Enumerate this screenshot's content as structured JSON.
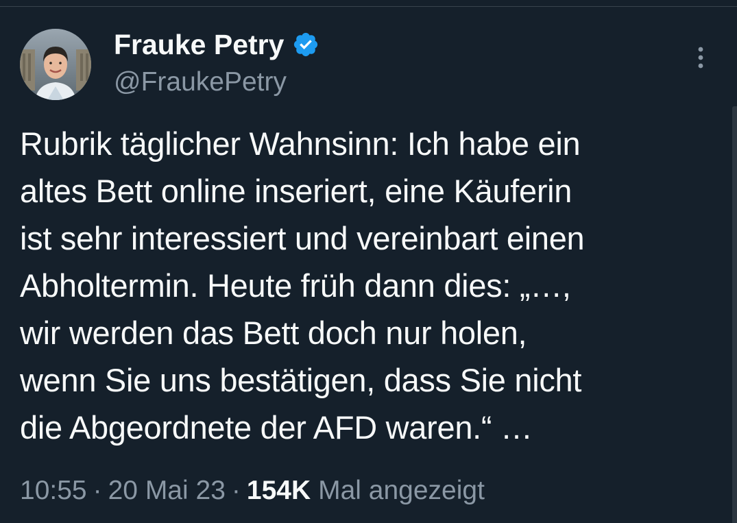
{
  "tweet": {
    "author": {
      "display_name": "Frauke Petry",
      "handle": "@FraukePetry",
      "verified": true,
      "verified_color": "#1d9bf0"
    },
    "text": "Rubrik täglicher Wahnsinn: Ich habe ein\naltes Bett online inseriert, eine Käuferin\nist sehr interessiert und vereinbart einen\nAbholtermin. Heute früh dann dies: „…,\nwir werden das Bett doch nur holen,\nwenn Sie uns bestätigen, dass Sie nicht\ndie Abgeordnete der AFD waren.“ …",
    "meta": {
      "time": "10:55",
      "separator": "·",
      "date": "20 Mai 23",
      "views_count": "154K",
      "views_label": "Mal angezeigt"
    }
  },
  "icons": {
    "verified": "verified-badge-icon",
    "more": "more-vertical-icon"
  },
  "colors": {
    "background": "#15202b",
    "primary_text": "#f7f9f9",
    "secondary_text": "#8b98a5",
    "accent": "#1d9bf0"
  }
}
